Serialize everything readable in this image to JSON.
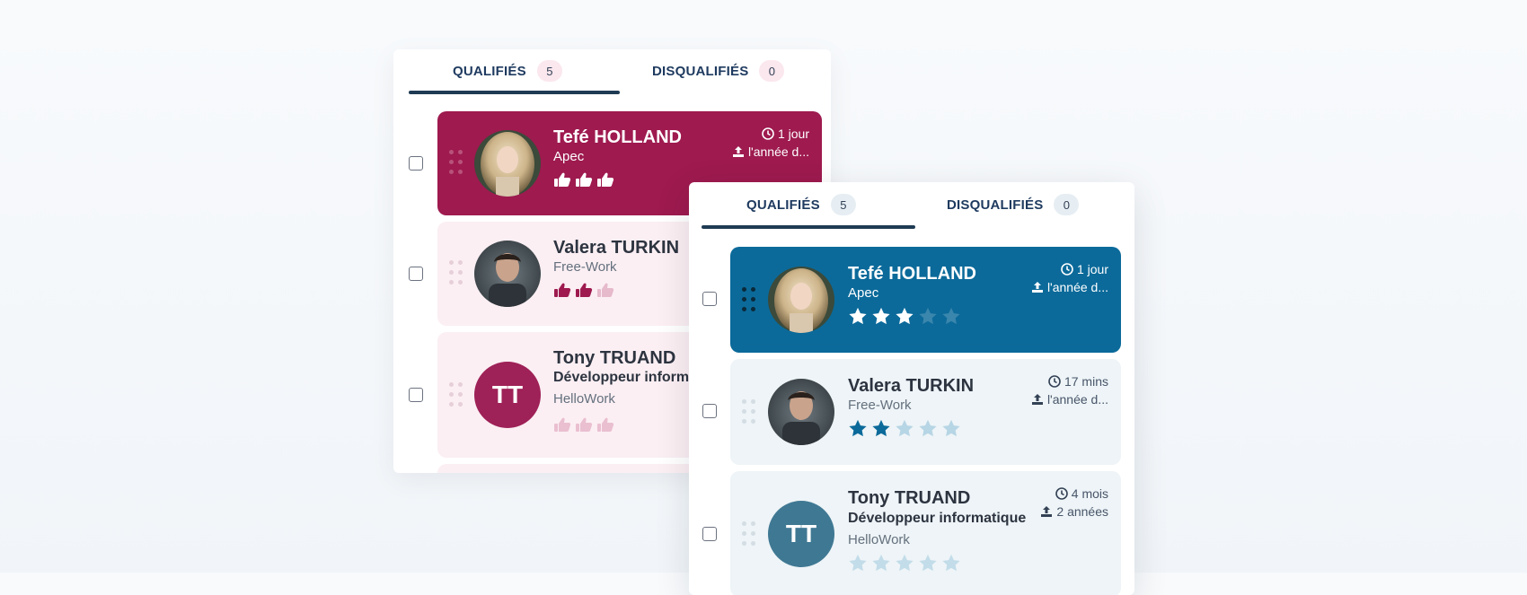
{
  "back_panel": {
    "tabs": [
      {
        "label": "QUALIFIÉS",
        "count": "5"
      },
      {
        "label": "DISQUALIFIÉS",
        "count": "0"
      }
    ],
    "rating_style": "thumbs",
    "cards": [
      {
        "name": "Tefé HOLLAND",
        "source": "Apec",
        "time": "1 jour",
        "experience": "l'année d...",
        "thumbs_filled": 3,
        "thumbs_total": 3
      },
      {
        "name": "Valera TURKIN",
        "source": "Free-Work",
        "thumbs_filled": 2,
        "thumbs_total": 3
      },
      {
        "initials": "TT",
        "name": "Tony TRUAND",
        "job": "Développeur inform",
        "source": "HelloWork",
        "thumbs_filled": 0,
        "thumbs_total": 3
      }
    ],
    "colors": {
      "accent": "#9e1a4f",
      "card_bg": "#fbeff3",
      "underline": "#1f3b54"
    }
  },
  "front_panel": {
    "tabs": [
      {
        "label": "QUALIFIÉS",
        "count": "5"
      },
      {
        "label": "DISQUALIFIÉS",
        "count": "0"
      }
    ],
    "rating_style": "stars",
    "cards": [
      {
        "name": "Tefé HOLLAND",
        "source": "Apec",
        "time": "1 jour",
        "experience": "l'année d...",
        "stars_filled": 3,
        "stars_total": 5
      },
      {
        "name": "Valera TURKIN",
        "source": "Free-Work",
        "time": "17 mins",
        "experience": "l'année d...",
        "stars_filled": 2,
        "stars_total": 5
      },
      {
        "initials": "TT",
        "name": "Tony TRUAND",
        "job": "Développeur informatique",
        "source": "HelloWork",
        "time": "4 mois",
        "experience": "2 années",
        "stars_filled": 0,
        "stars_total": 5
      }
    ],
    "colors": {
      "accent": "#0b6a9a",
      "card_bg": "#eef4f7",
      "underline": "#1f3b54"
    }
  },
  "icons": {
    "clock": "clock-icon",
    "upload": "upload-icon",
    "thumb": "thumbs-up-icon",
    "star": "star-icon",
    "drag": "drag-handle-icon"
  }
}
